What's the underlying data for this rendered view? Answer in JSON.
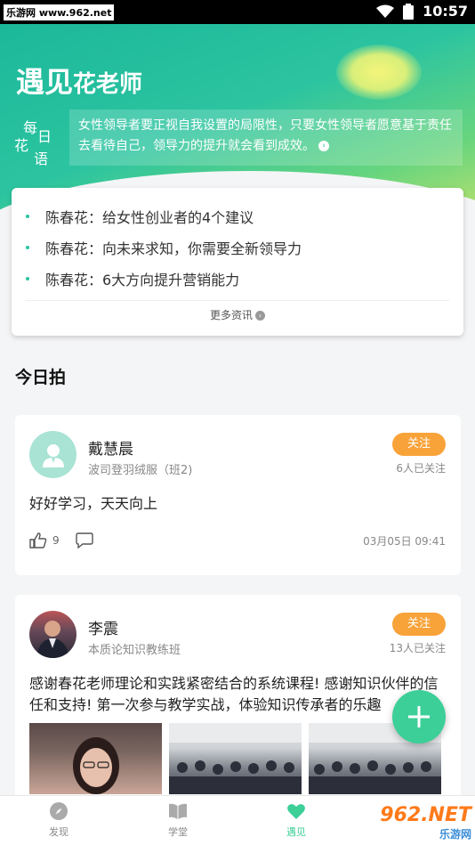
{
  "status_bar": {
    "site": "乐游网 www.962.net",
    "time": "10:57"
  },
  "header": {
    "title_big": "遇见",
    "title_small": "花老师"
  },
  "daily_quote": {
    "label_chars": [
      "每",
      "日",
      "花",
      "语"
    ],
    "text": "女性领导者要正视自我设置的局限性，只要女性领导者愿意基于责任去看待自己，领导力的提升就会看到成效。"
  },
  "news": {
    "items": [
      {
        "title": "陈春花：给女性创业者的4个建议"
      },
      {
        "title": "陈春花：向未来求知，你需要全新领导力"
      },
      {
        "title": "陈春花：6大方向提升营销能力"
      }
    ],
    "more_label": "更多资讯"
  },
  "today_section": {
    "title": "今日拍"
  },
  "posts": [
    {
      "author": "戴慧晨",
      "org": "波司登羽绒服（班2)",
      "follow_label": "关注",
      "followers": "6人已关注",
      "text": "好好学习，天天向上",
      "likes": "9",
      "time": "03月05日 09:41"
    },
    {
      "author": "李震",
      "org": "本质论知识教练班",
      "follow_label": "关注",
      "followers": "13人已关注",
      "text": "感谢春花老师理论和实践紧密结合的系统课程! 感谢知识伙伴的信任和支持! 第一次参与教学实战，体验知识传承者的乐趣"
    }
  ],
  "tabbar": {
    "tabs": [
      {
        "label": "发现",
        "icon": "compass-icon"
      },
      {
        "label": "学堂",
        "icon": "book-icon"
      },
      {
        "label": "遇见",
        "icon": "heart-icon"
      }
    ]
  },
  "watermark": {
    "big": "962.NET",
    "small": "乐游网"
  },
  "colors": {
    "accent": "#3ccf98",
    "follow": "#f8a33a",
    "hero_start": "#1bb89a",
    "hero_end": "#c8e36a"
  }
}
